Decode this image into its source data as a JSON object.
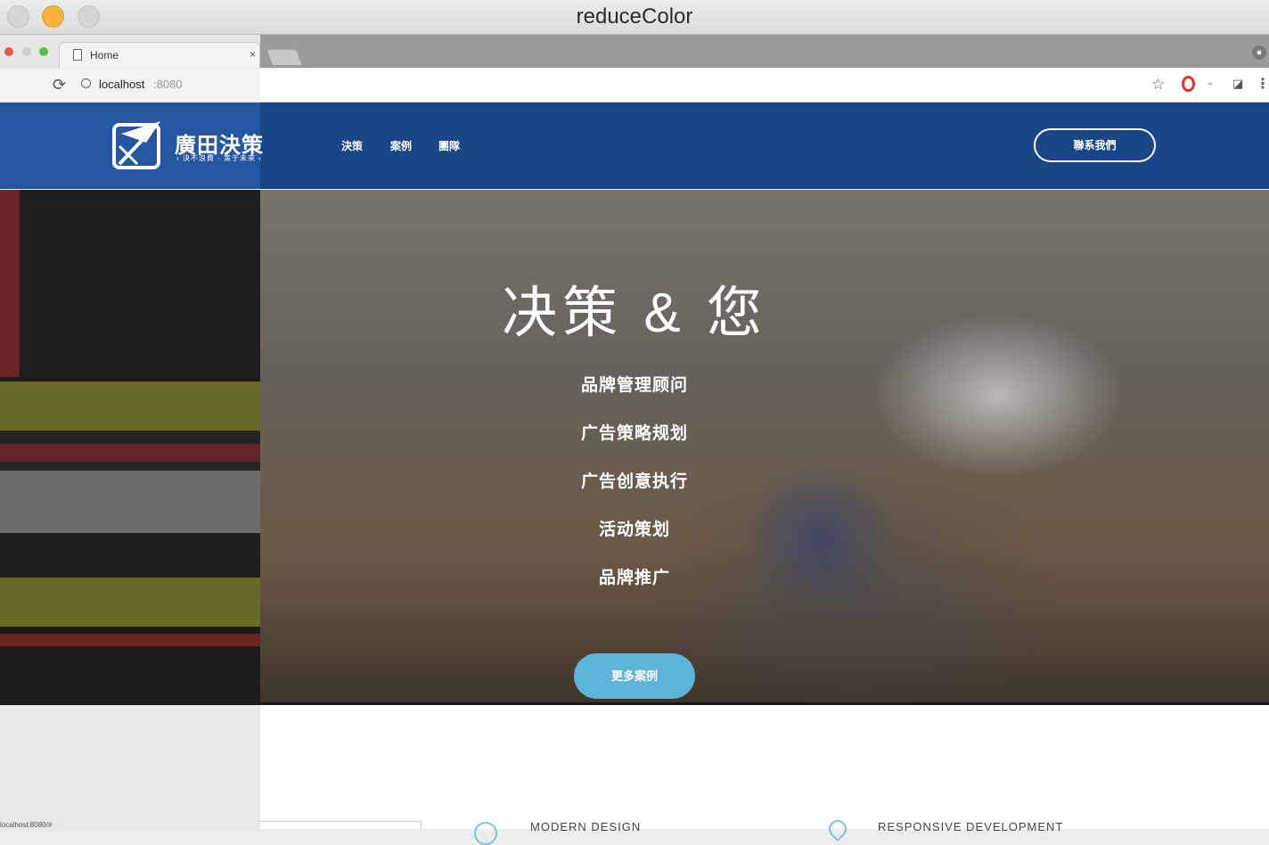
{
  "window": {
    "title": "reduceColor"
  },
  "browser": {
    "tab_title": "Home",
    "tab_close": "×",
    "url_host": "localhost",
    "url_port": ":8080",
    "profile_icon": "person-icon",
    "status_url": "localhost:8080/#"
  },
  "nav": {
    "logo_text": "廣田決策",
    "logo_slogan": "› 決不浪費 · 策于未來 ‹",
    "links": [
      "決策",
      "案例",
      "團隊"
    ],
    "contact": "聯系我們",
    "background": "#1a4687"
  },
  "hero": {
    "title": "决策 & 您",
    "services": [
      "品牌管理顾问",
      "广告策略规划",
      "广告创意执行",
      "活动策划",
      "品牌推广"
    ],
    "more_button": "更多案例",
    "more_button_color": "#5cb5d9"
  },
  "features": [
    {
      "icon": "circle-icon",
      "title": "MODERN DESIGN"
    },
    {
      "icon": "drop-icon",
      "title": "RESPONSIVE DEVELOPMENT"
    }
  ]
}
